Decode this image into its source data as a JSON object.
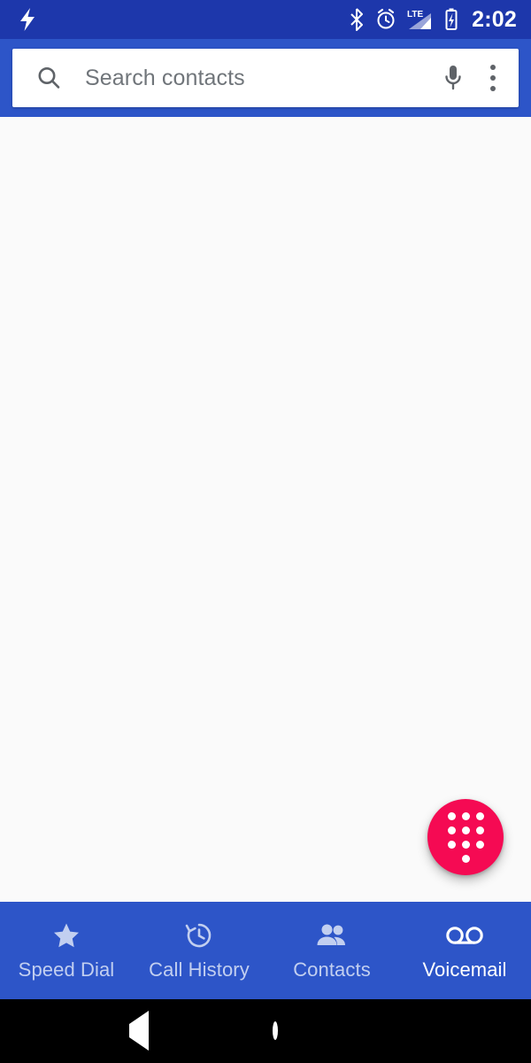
{
  "status_bar": {
    "left_icons": [
      {
        "name": "flash-icon",
        "label": "flash"
      }
    ],
    "right_icons": [
      {
        "name": "bluetooth-icon",
        "label": "bluetooth"
      },
      {
        "name": "alarm-clock-icon",
        "label": "alarm"
      },
      {
        "name": "lte-signal-icon",
        "label": "LTE"
      },
      {
        "name": "battery-charging-icon",
        "label": "battery charging"
      }
    ],
    "lte_label": "LTE",
    "time": "2:02",
    "background_color": "#1d37ab"
  },
  "app_bar": {
    "background_color": "#2d55c8",
    "search": {
      "placeholder": "Search contacts",
      "value": "",
      "search_icon": "search-icon",
      "mic_icon": "microphone-icon",
      "overflow_icon": "overflow-menu-icon"
    }
  },
  "content": {
    "background_color": "#fafafa",
    "items": []
  },
  "fab": {
    "name": "dialpad-fab",
    "icon": "dialpad-icon",
    "color": "#f50a53",
    "dot_count": 10
  },
  "bottom_nav": {
    "background_color": "#2d55c8",
    "active_index": 3,
    "tabs": [
      {
        "label": "Speed Dial",
        "icon": "star-icon",
        "name": "tab-speed-dial"
      },
      {
        "label": "Call History",
        "icon": "history-clock-icon",
        "name": "tab-call-history"
      },
      {
        "label": "Contacts",
        "icon": "people-icon",
        "name": "tab-contacts"
      },
      {
        "label": "Voicemail",
        "icon": "voicemail-icon",
        "name": "tab-voicemail"
      }
    ]
  },
  "system_nav": {
    "background_color": "#000000",
    "buttons": [
      {
        "name": "nav-back-button",
        "icon": "back-triangle-icon"
      },
      {
        "name": "nav-home-button",
        "icon": "home-circle-icon"
      },
      {
        "name": "nav-recents-button",
        "icon": "recents-square-icon"
      }
    ]
  }
}
